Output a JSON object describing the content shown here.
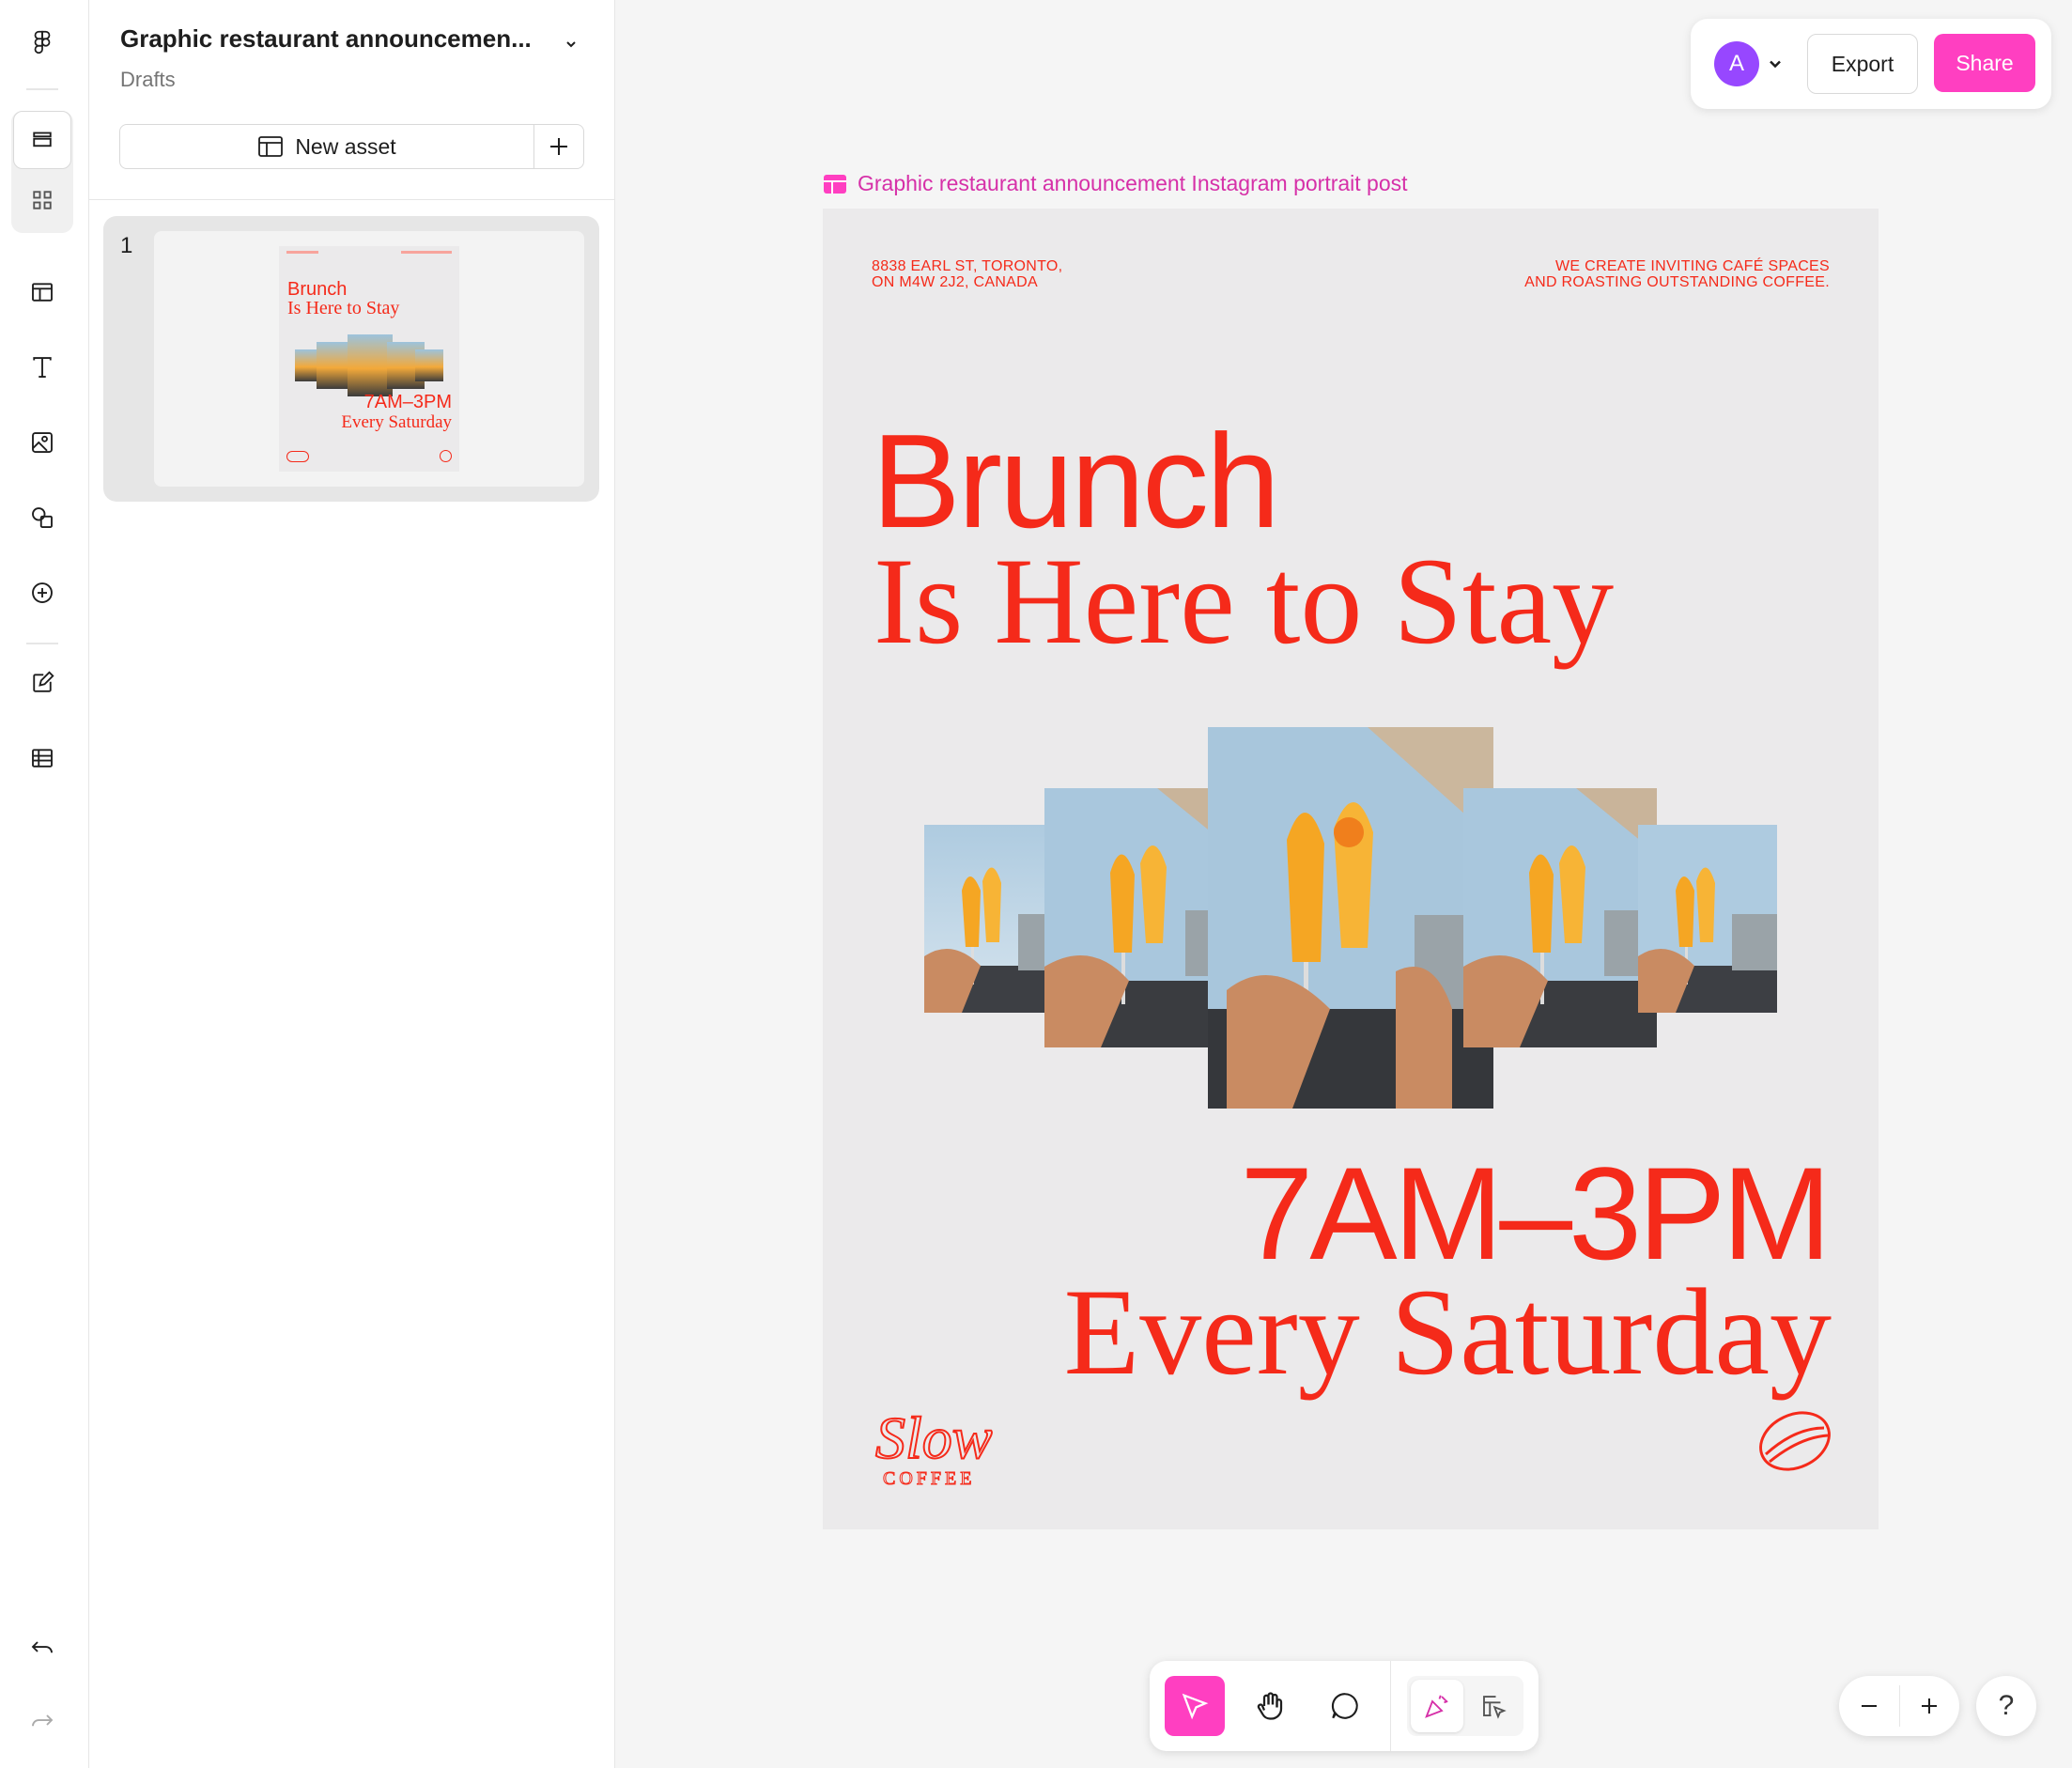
{
  "file": {
    "title": "Graphic restaurant announcemen...",
    "location": "Drafts"
  },
  "panel": {
    "new_asset_label": "New asset",
    "pages": [
      {
        "number": "1"
      }
    ],
    "thumbnail": {
      "headline_1": "Brunch",
      "headline_2": "Is Here to Stay",
      "hours": "7AM–3PM",
      "day": "Every Saturday"
    }
  },
  "toolbar": {
    "avatar_initial": "A",
    "export_label": "Export",
    "share_label": "Share"
  },
  "canvas": {
    "frame_label": "Graphic restaurant announcement Instagram portrait post",
    "poster": {
      "address_line_1": "8838 EARL ST, TORONTO,",
      "address_line_2": "ON M4W 2J2, CANADA",
      "tagline_line_1": "WE CREATE INVITING CAFÉ SPACES",
      "tagline_line_2": "AND ROASTING OUTSTANDING COFFEE.",
      "headline_1": "Brunch",
      "headline_2": "Is Here to Stay",
      "hours": "7AM–3PM",
      "day": "Every Saturday",
      "brand_script": "Slow",
      "brand_word": "COFFEE"
    }
  },
  "bottom_tools": [
    {
      "name": "move",
      "icon": "cursor-arrow-icon",
      "active": true
    },
    {
      "name": "hand",
      "icon": "hand-icon",
      "active": false
    },
    {
      "name": "comment",
      "icon": "comment-bubble-icon",
      "active": false
    },
    {
      "name": "actions",
      "icon": "confetti-icon",
      "active": false
    },
    {
      "name": "dev-mode",
      "icon": "layout-cursor-icon",
      "active": false
    }
  ],
  "help_label": "?",
  "colors": {
    "accent_pink": "#ff3fc1",
    "poster_red": "#f52a1a",
    "poster_bg": "#ebeaeb",
    "avatar_purple": "#9747ff",
    "frame_label": "#d630a8"
  }
}
